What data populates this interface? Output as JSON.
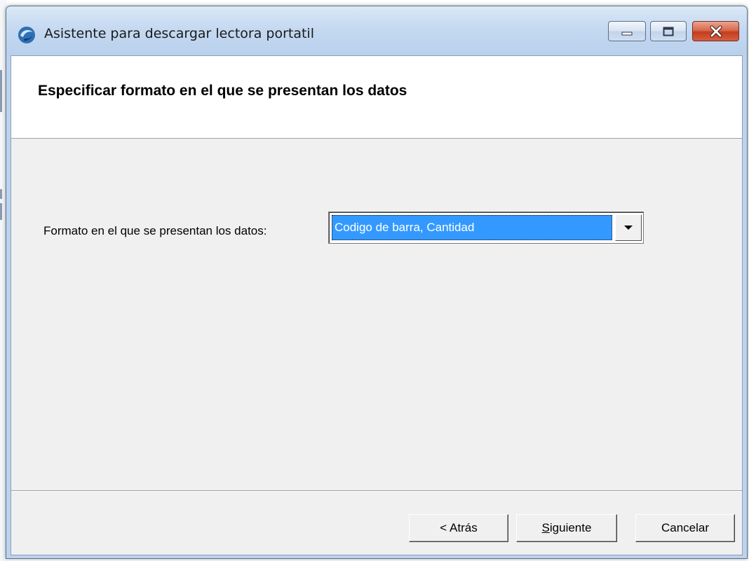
{
  "window": {
    "title": "Asistente para descargar lectora portatil",
    "icon": "app-logo-icon",
    "caption_buttons": [
      "minimize-icon",
      "maximize-icon",
      "close-icon"
    ]
  },
  "header": {
    "title": "Especificar formato en el que se presentan los datos"
  },
  "form": {
    "format_label": "Formato en el que se presentan los datos:",
    "format_select": {
      "selected": "Codigo de barra, Cantidad",
      "icon": "dropdown-arrow-icon"
    }
  },
  "footer": {
    "back_label": "< Atrás",
    "next_mnemonic": "S",
    "next_rest": "iguiente",
    "cancel_label": "Cancelar"
  },
  "colors": {
    "selection": "#3399ff",
    "client_bg": "#f0f0f0",
    "titlebar": "#c5d9f1",
    "close_button": "#c23e1f"
  }
}
